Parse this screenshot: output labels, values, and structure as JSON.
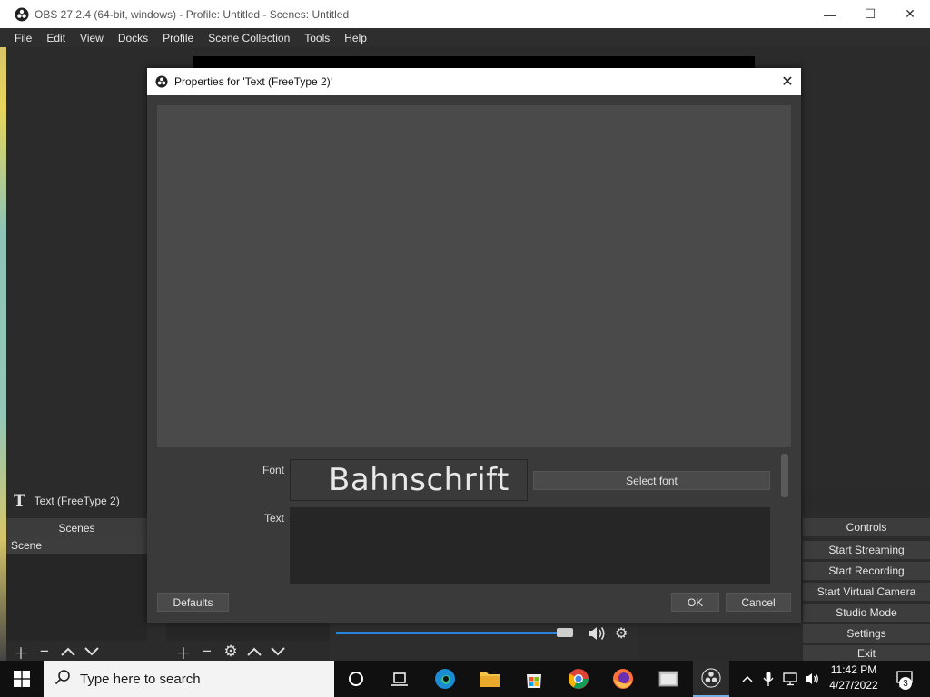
{
  "window": {
    "title": "OBS 27.2.4 (64-bit, windows) - Profile: Untitled - Scenes: Untitled",
    "minimize": "—",
    "maximize": "☐",
    "close": "✕"
  },
  "menu": [
    "File",
    "Edit",
    "View",
    "Docks",
    "Profile",
    "Scene Collection",
    "Tools",
    "Help"
  ],
  "source_bar": {
    "icon": "T",
    "label": "Text (FreeType 2)"
  },
  "scenes": {
    "header": "Scenes",
    "items": [
      "Scene"
    ]
  },
  "controls": {
    "header": "Controls",
    "buttons": [
      "Start Streaming",
      "Start Recording",
      "Start Virtual Camera",
      "Studio Mode",
      "Settings",
      "Exit"
    ]
  },
  "dialog": {
    "title": "Properties for 'Text (FreeType 2)'",
    "close": "✕",
    "font_label": "Font",
    "font_preview": "Bahnschrift",
    "select_font": "Select font",
    "text_label": "Text",
    "text_value": "",
    "defaults": "Defaults",
    "ok": "OK",
    "cancel": "Cancel"
  },
  "mixer": {
    "volume_fraction": 0.98
  },
  "taskbar": {
    "search_placeholder": "Type here to search",
    "time": "11:42 PM",
    "date": "4/27/2022",
    "notification_count": "3"
  },
  "colors": {
    "accent": "#2a82da",
    "dialog_bg": "#3a3a3a",
    "preview_bg": "#4a4a4a"
  }
}
